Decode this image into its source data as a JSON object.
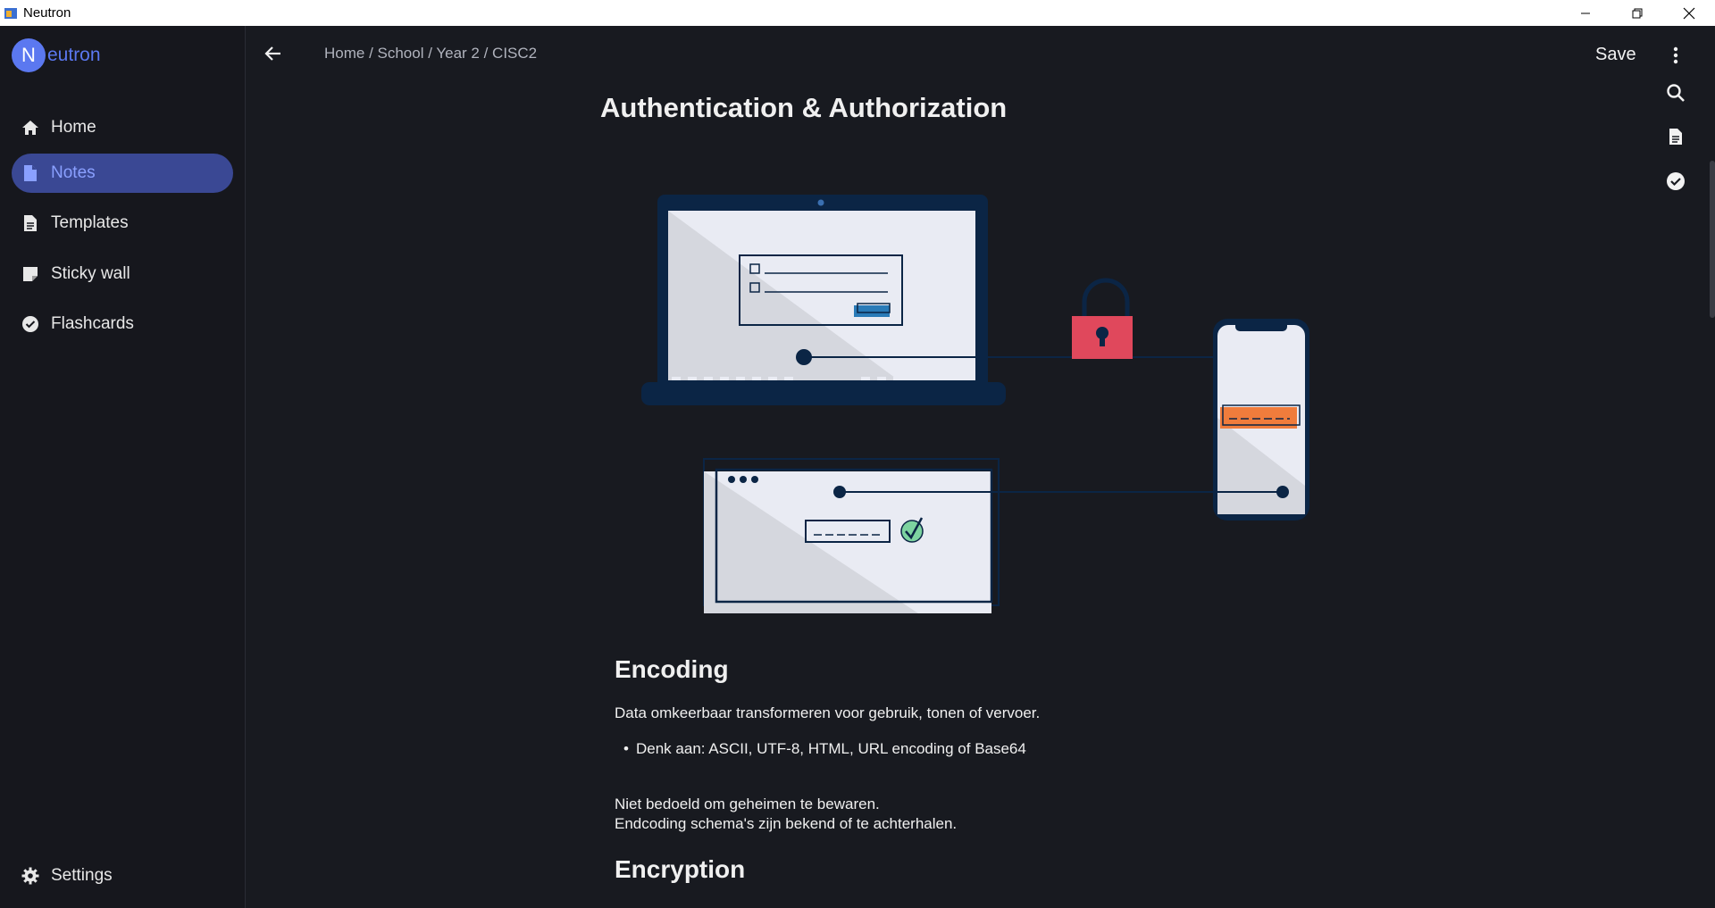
{
  "window": {
    "title": "Neutron"
  },
  "logo": {
    "letter": "N",
    "rest": "eutron"
  },
  "sidebar": {
    "items": [
      {
        "label": "Home",
        "icon": "home-icon",
        "active": false
      },
      {
        "label": "Notes",
        "icon": "note-icon",
        "active": true
      },
      {
        "label": "Templates",
        "icon": "document-icon",
        "active": false
      },
      {
        "label": "Sticky wall",
        "icon": "sticky-note-icon",
        "active": false
      },
      {
        "label": "Flashcards",
        "icon": "check-circle-icon",
        "active": false
      }
    ],
    "settings": {
      "label": "Settings",
      "icon": "gear-icon"
    }
  },
  "header": {
    "breadcrumb": "Home / School / Year 2 / CISC2",
    "save_label": "Save"
  },
  "document": {
    "title": "Authentication & Authorization",
    "sections": [
      {
        "heading": "Encoding",
        "paragraph": "Data omkeerbaar transformeren voor gebruik, tonen of vervoer.",
        "bullets": [
          "Denk aan: ASCII, UTF-8, HTML, URL encoding of Base64"
        ],
        "note_lines": [
          "Niet bedoeld om geheimen te bewaren.",
          "Endcoding schema's zijn bekend of te achterhalen."
        ]
      },
      {
        "heading": "Encryption"
      }
    ]
  },
  "colors": {
    "background": "#181a20",
    "sidebar": "#16171d",
    "accent": "#5b78f0",
    "active_nav": "#3a4894",
    "navy": "#0b2545",
    "lock_red": "#e0485c",
    "orange": "#f07c3c"
  }
}
